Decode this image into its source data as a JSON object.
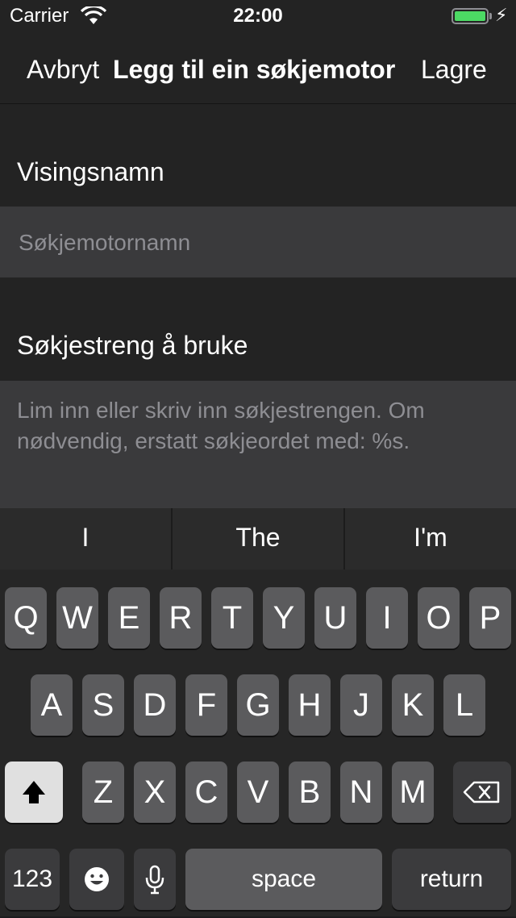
{
  "status_bar": {
    "carrier": "Carrier",
    "time": "22:00",
    "battery_level": 1.0,
    "battery_color": "#4cd964",
    "wifi_icon": "wifi-icon",
    "charging_icon": "bolt-icon"
  },
  "nav": {
    "cancel_label": "Avbryt",
    "title": "Legg til ein søkjemotor",
    "save_label": "Lagre"
  },
  "form": {
    "display_name": {
      "label": "Visingsnamn",
      "placeholder": "Søkjemotornamn",
      "value": ""
    },
    "search_string": {
      "label": "Søkjestreng å bruke",
      "placeholder": "Lim inn eller skriv inn søkjestrengen. Om nødvendig, erstatt søkjeordet med: %s.",
      "value": ""
    }
  },
  "keyboard": {
    "suggestions": [
      "I",
      "The",
      "I'm"
    ],
    "row1": [
      "Q",
      "W",
      "E",
      "R",
      "T",
      "Y",
      "U",
      "I",
      "O",
      "P"
    ],
    "row2": [
      "A",
      "S",
      "D",
      "F",
      "G",
      "H",
      "J",
      "K",
      "L"
    ],
    "row3": [
      "Z",
      "X",
      "C",
      "V",
      "B",
      "N",
      "M"
    ],
    "numbers_label": "123",
    "space_label": "space",
    "return_label": "return",
    "shift_icon": "shift-icon",
    "backspace_icon": "backspace-icon",
    "emoji_icon": "emoji-icon",
    "mic_icon": "microphone-icon"
  }
}
